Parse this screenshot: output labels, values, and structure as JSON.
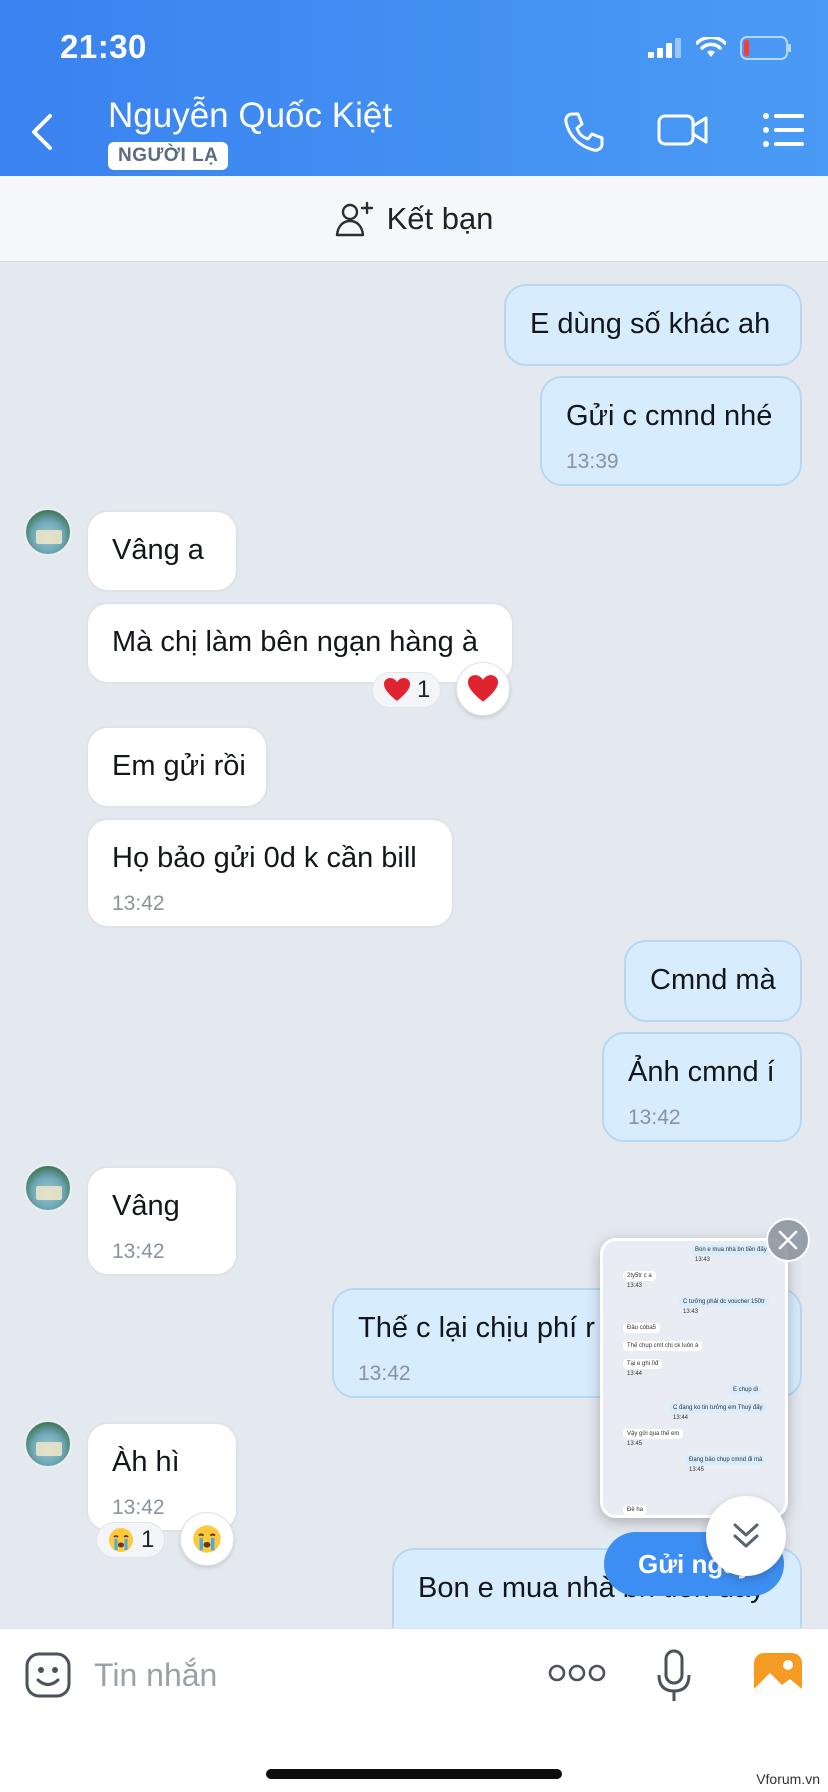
{
  "status_bar": {
    "time": "21:30"
  },
  "header": {
    "contact_name": "Nguyễn Quốc Kiệt",
    "badge": "NGƯỜI LẠ",
    "icons": [
      "back-icon",
      "phone-icon",
      "video-icon",
      "menu-list-icon"
    ]
  },
  "friend_bar": {
    "label": "Kết bạn",
    "icon": "add-person-icon"
  },
  "messages": [
    {
      "side": "me",
      "text": "E dùng số khác ah"
    },
    {
      "side": "me",
      "text": "Gửi c cmnd nhé",
      "time": "13:39"
    },
    {
      "side": "them",
      "text": "Vâng a"
    },
    {
      "side": "them",
      "text": "Mà chị làm bên ngạn hàng à",
      "reaction": "1"
    },
    {
      "side": "them",
      "text": "Em gửi rồi"
    },
    {
      "side": "them",
      "text": "Họ bảo gửi 0d k cần bill",
      "time": "13:42"
    },
    {
      "side": "me",
      "text": "Cmnd mà"
    },
    {
      "side": "me",
      "text": "Ảnh cmnd í",
      "time": "13:42"
    },
    {
      "side": "them",
      "text": "Vâng",
      "time": "13:42"
    },
    {
      "side": "me",
      "text": "Thế c lại chịu phí r",
      "time": "13:42"
    },
    {
      "side": "them",
      "text": "Àh hì",
      "time": "13:42",
      "reaction": "1"
    },
    {
      "side": "me",
      "text": "Bon e mua nhà bn tiền đấy"
    }
  ],
  "preview": {
    "lines": [
      "Bon e mua nhà bn tiền đấy",
      "13:43",
      "2ty5tr c a",
      "13:43",
      "C tưởng phải dc voucher 150tr",
      "13:43",
      "Đâu cóba5",
      "Thế chụp cmt chị ck luôn à",
      "Tại e ghi 0đ",
      "13:44",
      "E chụp di",
      "C đang ko tin tưởng em Thuý đấy",
      "13:44",
      "Vậy gửi qua thế em",
      "13:45",
      "Đang bảo chụp cmnd đi mà",
      "13:45",
      "Đề ha"
    ]
  },
  "send_now": {
    "label": "Gửi ngay"
  },
  "input_bar": {
    "placeholder": "Tin nhắn"
  },
  "watermark": "Vforum.vn",
  "colors": {
    "header": "#3a82f0",
    "my_bubble": "#d7ecfd",
    "their_bubble": "#ffffff",
    "background": "#e4e8ef",
    "accent": "#3d8ef2"
  }
}
